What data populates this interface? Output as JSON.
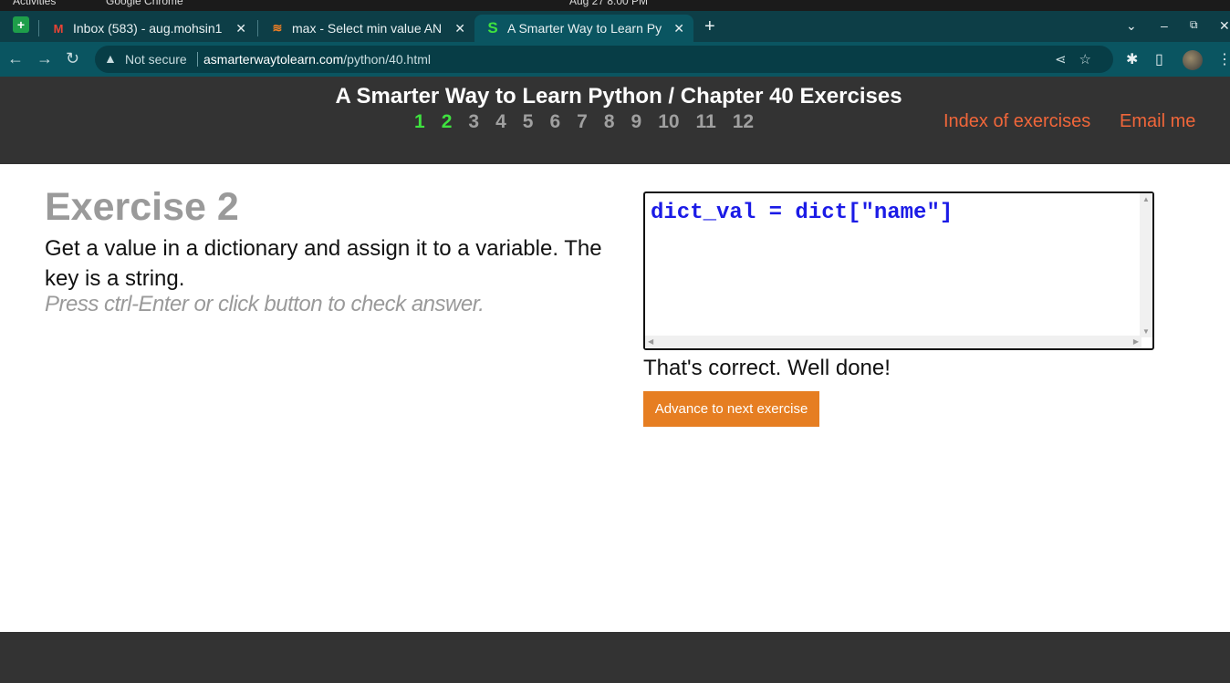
{
  "os_bar": {
    "activities": "Activities",
    "app": "Google Chrome",
    "clock": "Aug 27  8:00 PM"
  },
  "tabs": [
    {
      "title": "Inbox (583) - aug.mohsin1",
      "icon": "gmail-icon"
    },
    {
      "title": "max - Select min value AN",
      "icon": "stackoverflow-icon"
    },
    {
      "title": "A Smarter Way to Learn Py",
      "icon": "smarterway-icon",
      "active": true
    }
  ],
  "address_bar": {
    "security": "Not secure",
    "url_domain": "asmarterwaytolearn.com",
    "url_path": "/python/40.html"
  },
  "site_header": {
    "title": "A Smarter Way to Learn Python / Chapter 40 Exercises",
    "exercise_numbers": [
      "1",
      "2",
      "3",
      "4",
      "5",
      "6",
      "7",
      "8",
      "9",
      "10",
      "11",
      "12"
    ],
    "completed_count": 2,
    "index_link": "Index of exercises",
    "email_link": "Email me"
  },
  "exercise": {
    "heading": "Exercise 2",
    "description": "Get a value in a dictionary and assign it to a variable. The key is a string.",
    "hint": "Press ctrl-Enter or click button to check answer.",
    "code": "dict_val = dict[\"name\"]",
    "result": "That's correct. Well done!",
    "advance_button": "Advance to next exercise"
  },
  "colors": {
    "header_bg": "#333333",
    "completed_number": "#3fe23f",
    "link": "#f0663a",
    "button": "#e67e22",
    "code": "#1b1be6"
  }
}
